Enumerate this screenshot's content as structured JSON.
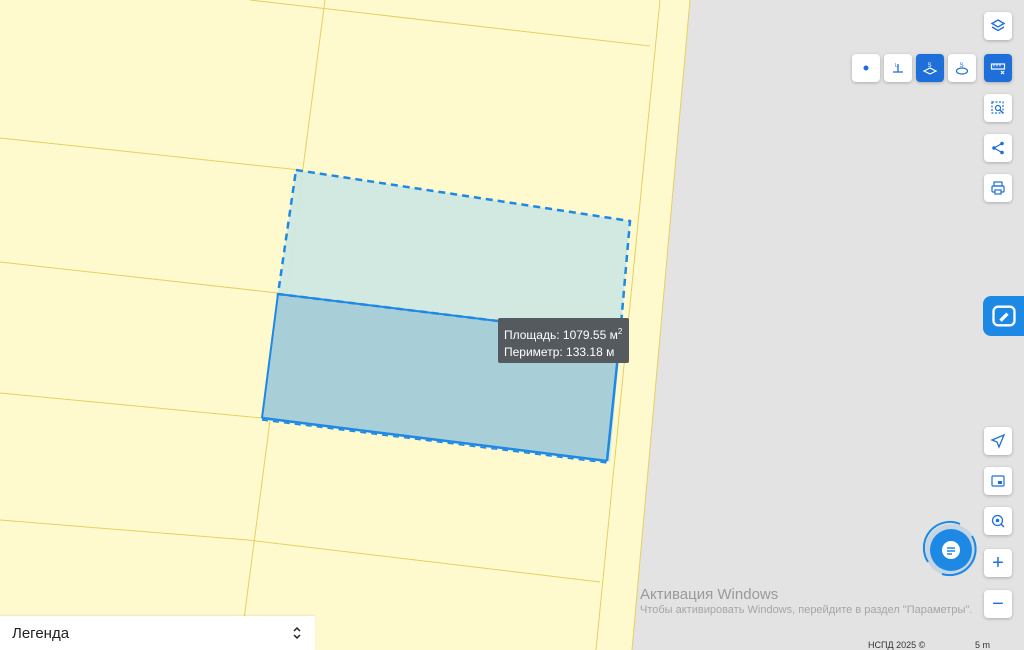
{
  "map": {
    "tooltip": {
      "area_label": "Площадь: 1079.55 м",
      "area_sup": "2",
      "perimeter_label": "Периметр: 133.18 м"
    },
    "colors": {
      "parcel_fill": "#fffacd",
      "parcel_border": "#e6cf63",
      "road_area": "#e3e3e3",
      "measure_stroke": "#1e88e5",
      "upper_poly_fill": "#cfe8e0",
      "lower_poly_fill": "#a8cfd8",
      "active_button": "#1e6fd9"
    }
  },
  "toolbar": {
    "layers_icon": "layers-icon",
    "point_icon": "point-measure-icon",
    "line_icon": "line-measure-icon",
    "area_icon": "area-measure-icon",
    "radius_icon": "radius-measure-icon",
    "ruler_icon": "ruler-close-icon",
    "select_icon": "area-select-icon",
    "share_icon": "share-icon",
    "print_icon": "print-icon",
    "locate_icon": "navigation-arrow-icon",
    "minimap_icon": "minimap-icon",
    "search_location_icon": "location-search-icon",
    "zoom_in": "+",
    "zoom_out": "−"
  },
  "legend": {
    "label": "Легенда",
    "toggle_icon": "chevron-up-down-icon"
  },
  "watermark": {
    "line1": "Активация Windows",
    "line2": "Чтобы активировать Windows, перейдите в раздел \"Параметры\"."
  },
  "footer": {
    "copyright": "НСПД 2025 ©",
    "scale": "5 m"
  }
}
